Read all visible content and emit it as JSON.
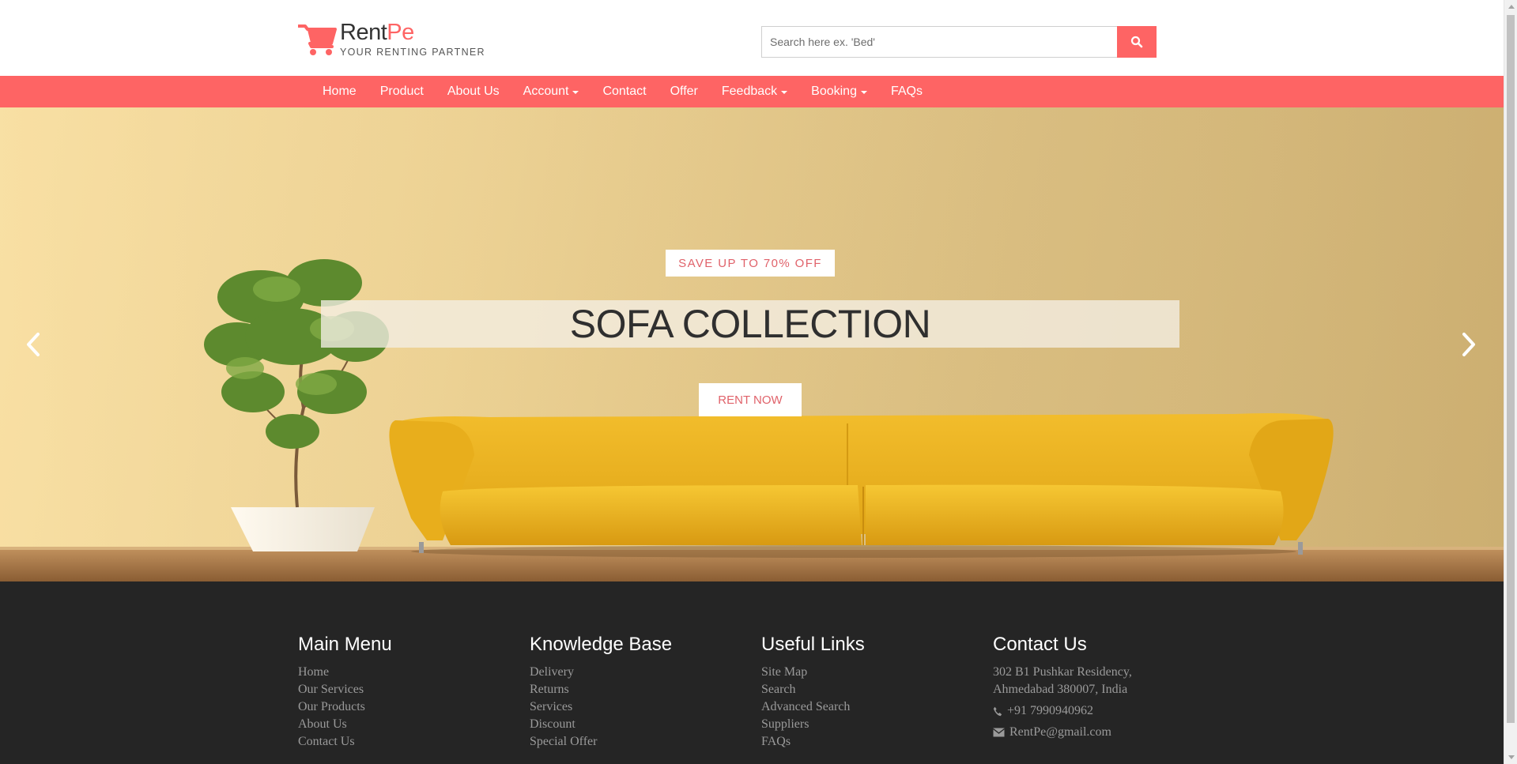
{
  "brand": {
    "name_part1": "Rent",
    "name_part2": "Pe",
    "tagline": "YOUR RENTING PARTNER",
    "accent_color": "#fe6464"
  },
  "search": {
    "placeholder": "Search here ex. 'Bed'",
    "button_icon": "search-icon"
  },
  "nav": {
    "items": [
      {
        "label": "Home",
        "dropdown": false
      },
      {
        "label": "Product",
        "dropdown": false
      },
      {
        "label": "About Us",
        "dropdown": false
      },
      {
        "label": "Account",
        "dropdown": true
      },
      {
        "label": "Contact",
        "dropdown": false
      },
      {
        "label": "Offer",
        "dropdown": false
      },
      {
        "label": "Feedback",
        "dropdown": true
      },
      {
        "label": "Booking",
        "dropdown": true
      },
      {
        "label": "FAQs",
        "dropdown": false
      }
    ]
  },
  "hero": {
    "badge": "SAVE UP TO 70% OFF",
    "headline": "SOFA COLLECTION",
    "cta": "RENT NOW",
    "prev_icon": "chevron-left-icon",
    "next_icon": "chevron-right-icon"
  },
  "footer": {
    "main_menu": {
      "title": "Main Menu",
      "links": [
        "Home",
        "Our Services",
        "Our Products",
        "About Us",
        "Contact Us"
      ]
    },
    "knowledge_base": {
      "title": "Knowledge Base",
      "links": [
        "Delivery",
        "Returns",
        "Services",
        "Discount",
        "Special Offer"
      ]
    },
    "useful_links": {
      "title": "Useful Links",
      "links": [
        "Site Map",
        "Search",
        "Advanced Search",
        "Suppliers",
        "FAQs"
      ]
    },
    "contact": {
      "title": "Contact Us",
      "address_line1": "302 B1 Pushkar Residency,",
      "address_line2": "Ahmedabad 380007, India",
      "phone": "+91 7990940962",
      "email": "RentPe@gmail.com"
    }
  }
}
